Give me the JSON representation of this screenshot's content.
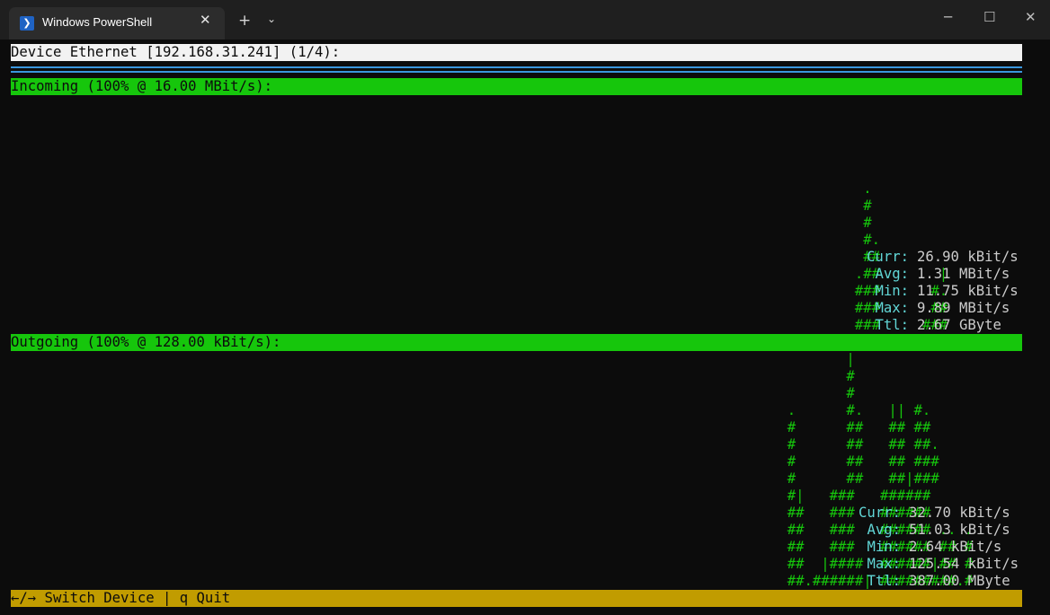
{
  "window": {
    "tab_title": "Windows PowerShell",
    "tab_close": "✕",
    "new_tab": "+",
    "dropdown": "⌄",
    "minimize": "─",
    "maximize": "☐",
    "close": "✕"
  },
  "colors": {
    "header_bg": "#f2f2f2",
    "section_green": "#16c60c",
    "separator_blue": "#3a96dd",
    "footer_yellow": "#c19c00",
    "label_cyan": "#61d6d6",
    "graph_green": "#16c60c"
  },
  "header": {
    "device": "Device Ethernet [192.168.31.241] (1/4):"
  },
  "incoming": {
    "title": "Incoming (100% @ 16.00 MBit/s):",
    "graph_rows": [
      "                                                                                                     .",
      "                                                                                                     #",
      "                                                                                                     #",
      "                                                                                                     #.",
      "                                                                                                     ##",
      "                                                                                                    .##       |",
      "                                                                                                    ###      #.",
      "                                                                                                    ###      ##",
      "                                                                                                    ###     ###"
    ],
    "stats": [
      {
        "label": "Curr:",
        "value": "26.90 kBit/s"
      },
      {
        "label": "Avg:",
        "value": "1.31 MBit/s"
      },
      {
        "label": "Min:",
        "value": "11.75 kBit/s"
      },
      {
        "label": "Max:",
        "value": "9.89 MBit/s"
      },
      {
        "label": "Ttl:",
        "value": "2.67 GByte"
      }
    ]
  },
  "outgoing": {
    "title": "Outgoing (100% @ 128.00 kBit/s):",
    "graph_rows": [
      "                                                                                                   |",
      "                                                                                                   #",
      "                                                                                                   #",
      "                                                                                            .      #.   || #.",
      "                                                                                            #      ##   ## ##",
      "                                                                                            #      ##   ## ##.",
      "                                                                                            #      ##   ## ###",
      "                                                                                            #      ##   ##|###",
      "                                                                                            #|   ###   ######",
      "                                                                                            ##   ###   ######",
      "                                                                                            ##   ###   ###### .. .",
      "                                                                                            ##   ###   ###### ## #",
      "                                                                                            ##  |####  ######|## #",
      "                                                                                            ##.######| #########.#"
    ],
    "stats": [
      {
        "label": "Curr:",
        "value": "32.70 kBit/s"
      },
      {
        "label": "Avg:",
        "value": "51.03 kBit/s"
      },
      {
        "label": "Min:",
        "value": "2.64 kBit/s"
      },
      {
        "label": "Max:",
        "value": "125.54 kBit/s"
      },
      {
        "label": "Ttl:",
        "value": "387.00 MByte"
      }
    ]
  },
  "footer": {
    "help": "←/→ Switch Device | q Quit"
  }
}
